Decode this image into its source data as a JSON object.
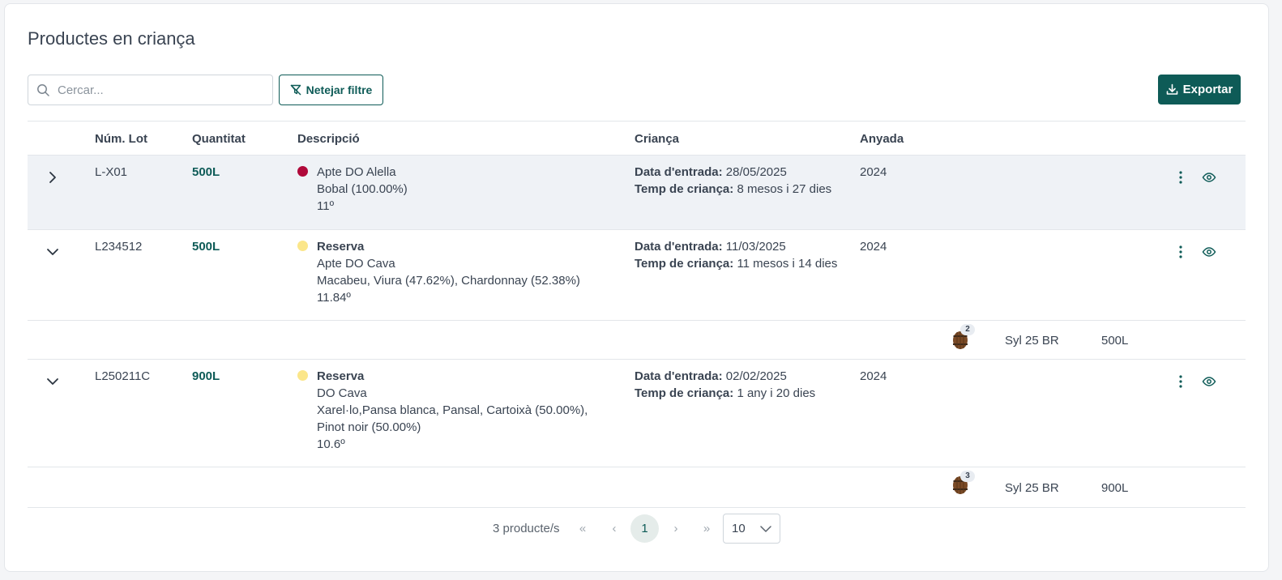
{
  "page": {
    "title": "Productes en criança"
  },
  "toolbar": {
    "search_placeholder": "Cercar...",
    "clear_filter_label": "Netejar filtre",
    "export_label": "Exportar"
  },
  "table": {
    "headers": [
      "Núm. Lot",
      "Quantitat",
      "Descripció",
      "Criança",
      "Anyada"
    ],
    "rows": [
      {
        "lot": "L-X01",
        "qty": "500L",
        "dot_color": "#b0093a",
        "title": "",
        "desc1": "Apte DO Alella",
        "desc2": "Bobal (100.00%)",
        "desc3": "11º",
        "desc4": "",
        "entry_label": "Data d'entrada:",
        "entry_value": "28/05/2025",
        "aging_label": "Temp de criança:",
        "aging_value": "8 mesos i 27 dies",
        "vintage": "2024",
        "expanded": false
      },
      {
        "lot": "L234512",
        "qty": "500L",
        "dot_color": "#fbe68a",
        "title": "Reserva",
        "desc1": "Apte DO Cava",
        "desc2": "Macabeu, Viura (47.62%), Chardonnay (52.38%)",
        "desc3": "11.84º",
        "desc4": "",
        "entry_label": "Data d'entrada:",
        "entry_value": "11/03/2025",
        "aging_label": "Temp de criança:",
        "aging_value": "11 mesos i 14 dies",
        "vintage": "2024",
        "expanded": true,
        "sub": {
          "badge": "2",
          "container": "Syl 25 BR",
          "amount": "500L"
        }
      },
      {
        "lot": "L250211C",
        "qty": "900L",
        "dot_color": "#fbe68a",
        "title": "Reserva",
        "desc1": "DO Cava",
        "desc2": "Xarel·lo,Pansa blanca, Pansal, Cartoixà (50.00%),",
        "desc3": "Pinot noir (50.00%)",
        "desc4": "10.6º",
        "entry_label": "Data d'entrada:",
        "entry_value": "02/02/2025",
        "aging_label": "Temp de criança:",
        "aging_value": "1 any i 20 dies",
        "vintage": "2024",
        "expanded": true,
        "sub": {
          "badge": "3",
          "container": "Syl 25 BR",
          "amount": "900L"
        }
      }
    ]
  },
  "pagination": {
    "count_label": "3 producte/s",
    "first": "«",
    "prev": "‹",
    "current": "1",
    "next": "›",
    "last": "»",
    "page_size": "10"
  },
  "colors": {
    "accent": "#0e5b57"
  }
}
